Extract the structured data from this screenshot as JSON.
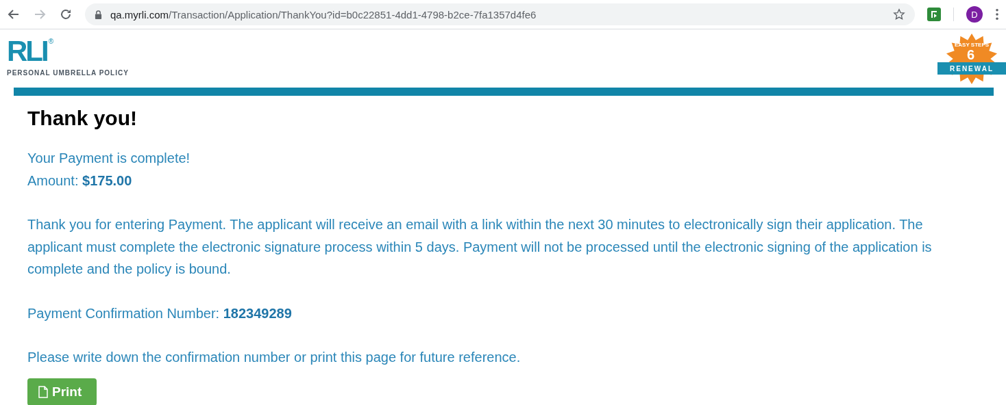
{
  "browser": {
    "url_host": "qa.myrli.com",
    "url_path": "/Transaction/Application/ThankYou?id=b0c22851-4dd1-4798-b2ce-7fa1357d4fe6",
    "profile_initial": "D"
  },
  "header": {
    "logo": "RLI",
    "logo_mark": "®",
    "subtitle": "PERSONAL UMBRELLA POLICY",
    "badge": {
      "arc": "EASY STEPS",
      "number": "6",
      "ribbon": "RENEWAL"
    }
  },
  "heading": "Thank you!",
  "status": "Your Payment is complete!",
  "amount": "Amount: **$175.00**",
  "message": "Thank you for entering Payment. The applicant will receive an email with a link within the next 30 minutes to electronically sign their application. The applicant must complete the electronic signature process within 5 days. Payment will not be processed until the electronic signing of the application is complete and the policy is bound.",
  "confirmation": "Payment Confirmation Number: **182349289**",
  "note": "Please write down the confirmation number or print this page for future reference.",
  "print_button": "Print"
}
